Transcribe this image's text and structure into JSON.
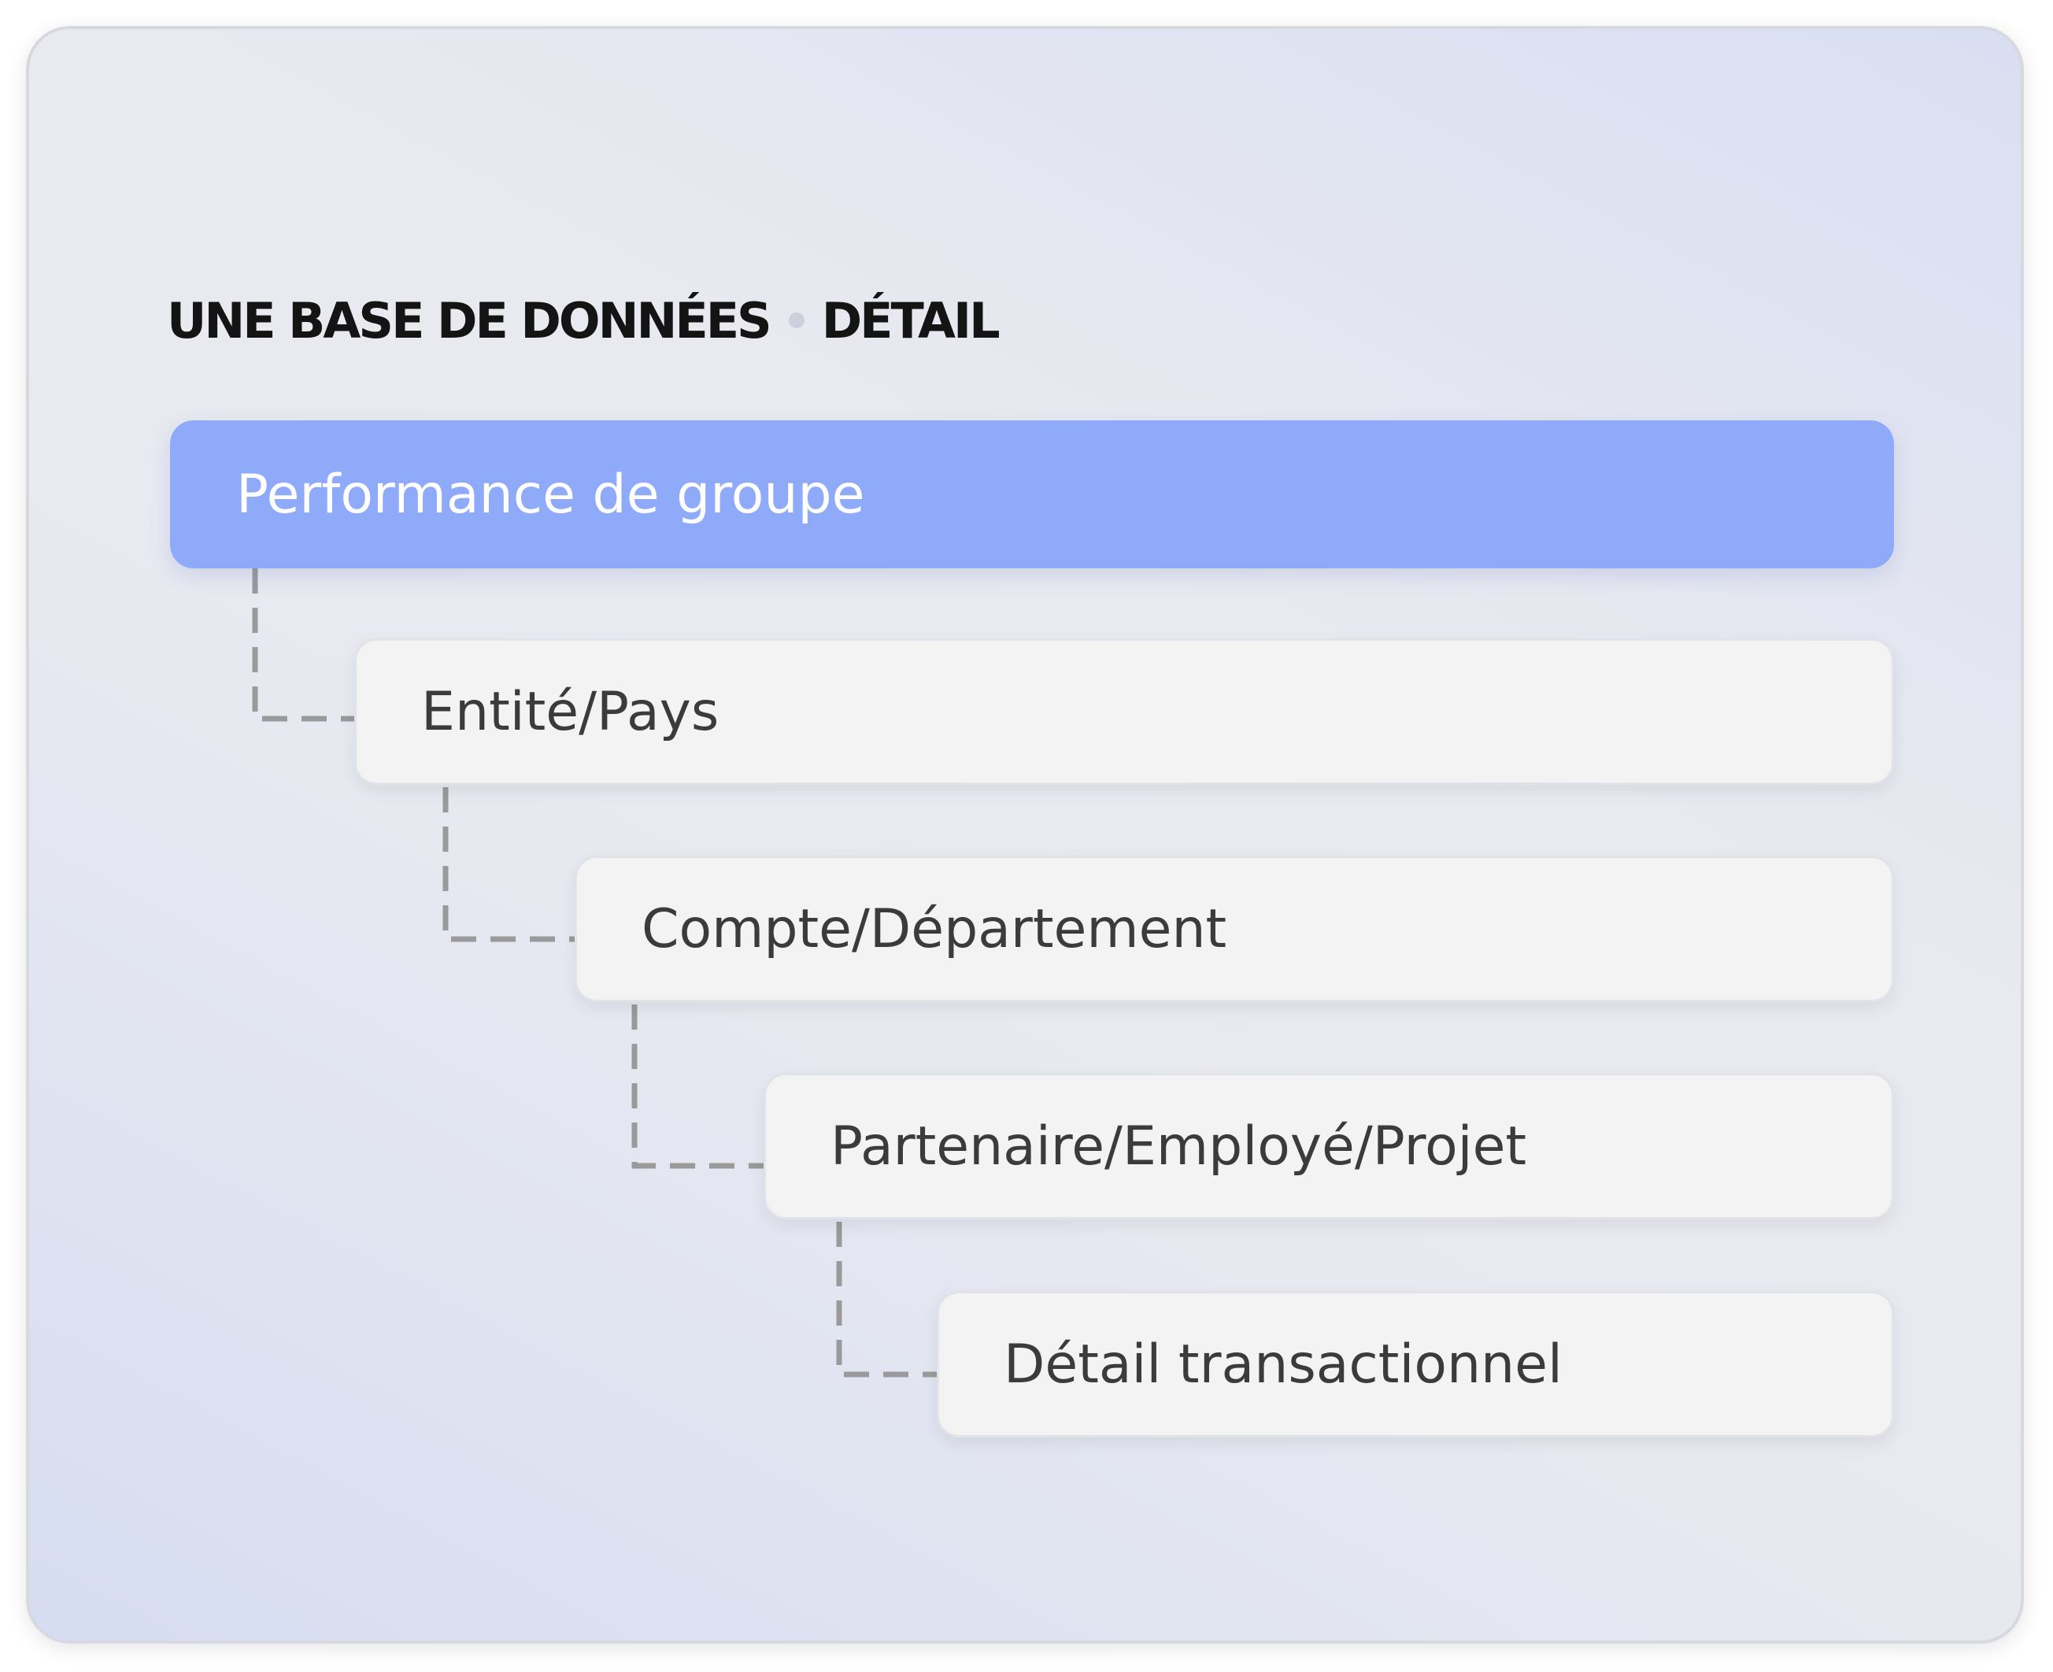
{
  "header": {
    "title_left": "UNE BASE DE DONNÉES",
    "title_right": "DÉTAIL"
  },
  "hierarchy": {
    "levels": [
      {
        "label": "Performance de groupe"
      },
      {
        "label": "Entité/Pays"
      },
      {
        "label": "Compte/Département"
      },
      {
        "label": "Partenaire/Employé/Projet"
      },
      {
        "label": "Détail transactionnel"
      }
    ]
  },
  "colors": {
    "root_fill": "#8faaf8",
    "level_fill": "#f3f3f4",
    "connector": "#9a9a9a",
    "heading_text": "#141414",
    "level_text": "#3b3b3b"
  }
}
